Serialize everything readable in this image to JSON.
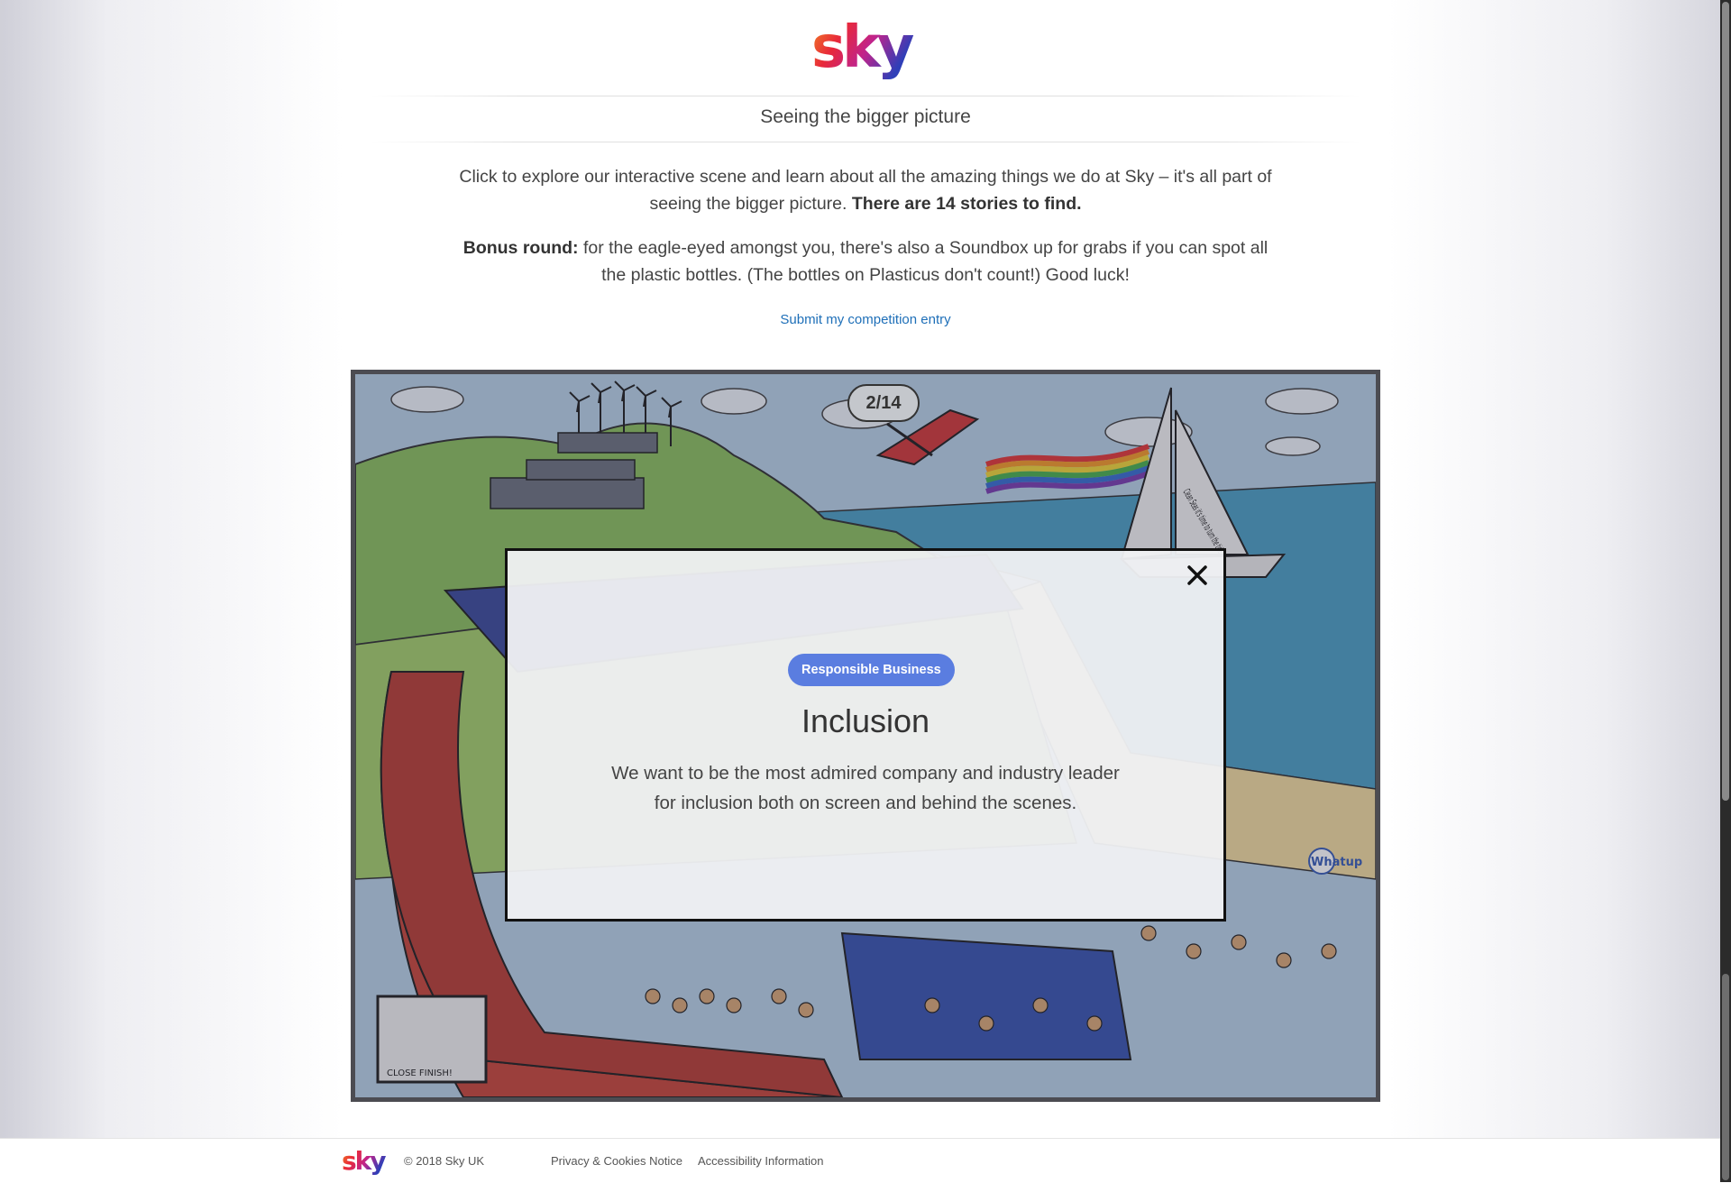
{
  "brand": {
    "logo_text": "sky"
  },
  "header": {
    "subtitle": "Seeing the bigger picture"
  },
  "intro": {
    "p1_text": "Click to explore our interactive scene and learn about all the amazing things we do at Sky – it's all part of seeing the bigger picture.",
    "p1_bold": "There are 14 stories to find.",
    "p2_bold": "Bonus round:",
    "p2_text": "for the eagle-eyed amongst you, there's also a Soundbox up for grabs if you can spot all the plastic bottles. (The bottles on Plasticus don't count!) Good luck!"
  },
  "competition_link": "Submit my competition entry",
  "scene": {
    "counter": "2/14",
    "sign_text": "CLOSE FINISH!",
    "sail_text": "Clean Seas it's time to turn the tide",
    "brand_text": "Whatup"
  },
  "modal": {
    "tag": "Responsible Business",
    "title": "Inclusion",
    "body": "We want to be the most admired company and industry leader for inclusion both on screen and behind the scenes."
  },
  "footer": {
    "copyright": "© 2018 Sky UK",
    "links": [
      "Privacy & Cookies Notice",
      "Accessibility Information"
    ]
  },
  "colors": {
    "tag_bg": "#5a7de0",
    "link": "#1e6fb8",
    "overlay_border": "#111111"
  }
}
